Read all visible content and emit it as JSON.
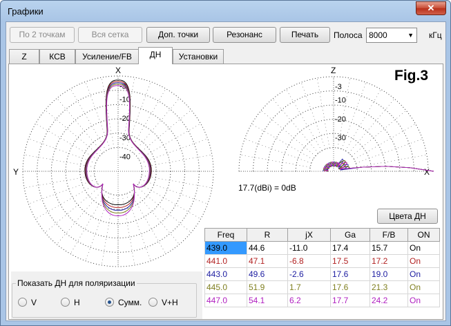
{
  "window": {
    "title": "Графики",
    "close_glyph": "✕"
  },
  "toolbar": {
    "by_two_points": "По 2 точкам",
    "whole_grid": "Вся сетка",
    "extra_points": "Доп. точки",
    "resonance": "Резонанс",
    "print": "Печать",
    "band_label": "Полоса",
    "band_value": "8000",
    "band_unit": "кГц"
  },
  "tabs": [
    {
      "label": "Z"
    },
    {
      "label": "КСВ"
    },
    {
      "label": "Усиление/FB"
    },
    {
      "label": "ДН"
    },
    {
      "label": "Установки"
    }
  ],
  "active_tab": "ДН",
  "fig_label": "Fig.3",
  "gain_note": "17.7(dBi) = 0dB",
  "colors_button": "Цвета ДН",
  "chart_data": [
    {
      "type": "polar",
      "name": "horizontal-pattern",
      "axis_labels": {
        "top": "X",
        "left": "Y"
      },
      "ring_labels": [
        "-3",
        "-10",
        "-20",
        "-30",
        "-40"
      ],
      "ring_db": [
        -3,
        -10,
        -20,
        -30,
        -40
      ],
      "series_colors": [
        "#000000",
        "#b22222",
        "#1c1ca0",
        "#7f7f1f",
        "#b020c0"
      ]
    },
    {
      "type": "polar",
      "name": "vertical-pattern",
      "axis_labels": {
        "top": "Z",
        "right": "X"
      },
      "ring_labels": [
        "-3",
        "-10",
        "-20",
        "-30"
      ],
      "ring_db": [
        -3,
        -10,
        -20,
        -30
      ]
    }
  ],
  "table": {
    "headers": [
      "Freq",
      "R",
      "jX",
      "Ga",
      "F/B",
      "ON"
    ],
    "rows": [
      {
        "freq": "439.0",
        "r": "44.6",
        "jx": "-11.0",
        "ga": "17.4",
        "fb": "15.7",
        "on": "On",
        "color": "#000000"
      },
      {
        "freq": "441.0",
        "r": "47.1",
        "jx": "-6.8",
        "ga": "17.5",
        "fb": "17.2",
        "on": "On",
        "color": "#b22222"
      },
      {
        "freq": "443.0",
        "r": "49.6",
        "jx": "-2.6",
        "ga": "17.6",
        "fb": "19.0",
        "on": "On",
        "color": "#1c1ca0"
      },
      {
        "freq": "445.0",
        "r": "51.9",
        "jx": "1.7",
        "ga": "17.6",
        "fb": "21.3",
        "on": "On",
        "color": "#7f7f1f"
      },
      {
        "freq": "447.0",
        "r": "54.1",
        "jx": "6.2",
        "ga": "17.7",
        "fb": "24.2",
        "on": "On",
        "color": "#b020c0"
      }
    ]
  },
  "polarization": {
    "group_label": "Показать ДН для поляризации",
    "options": [
      {
        "label": "V",
        "checked": false
      },
      {
        "label": "H",
        "checked": false
      },
      {
        "label": "Сумм.",
        "checked": true
      },
      {
        "label": "V+H",
        "checked": false
      }
    ]
  }
}
